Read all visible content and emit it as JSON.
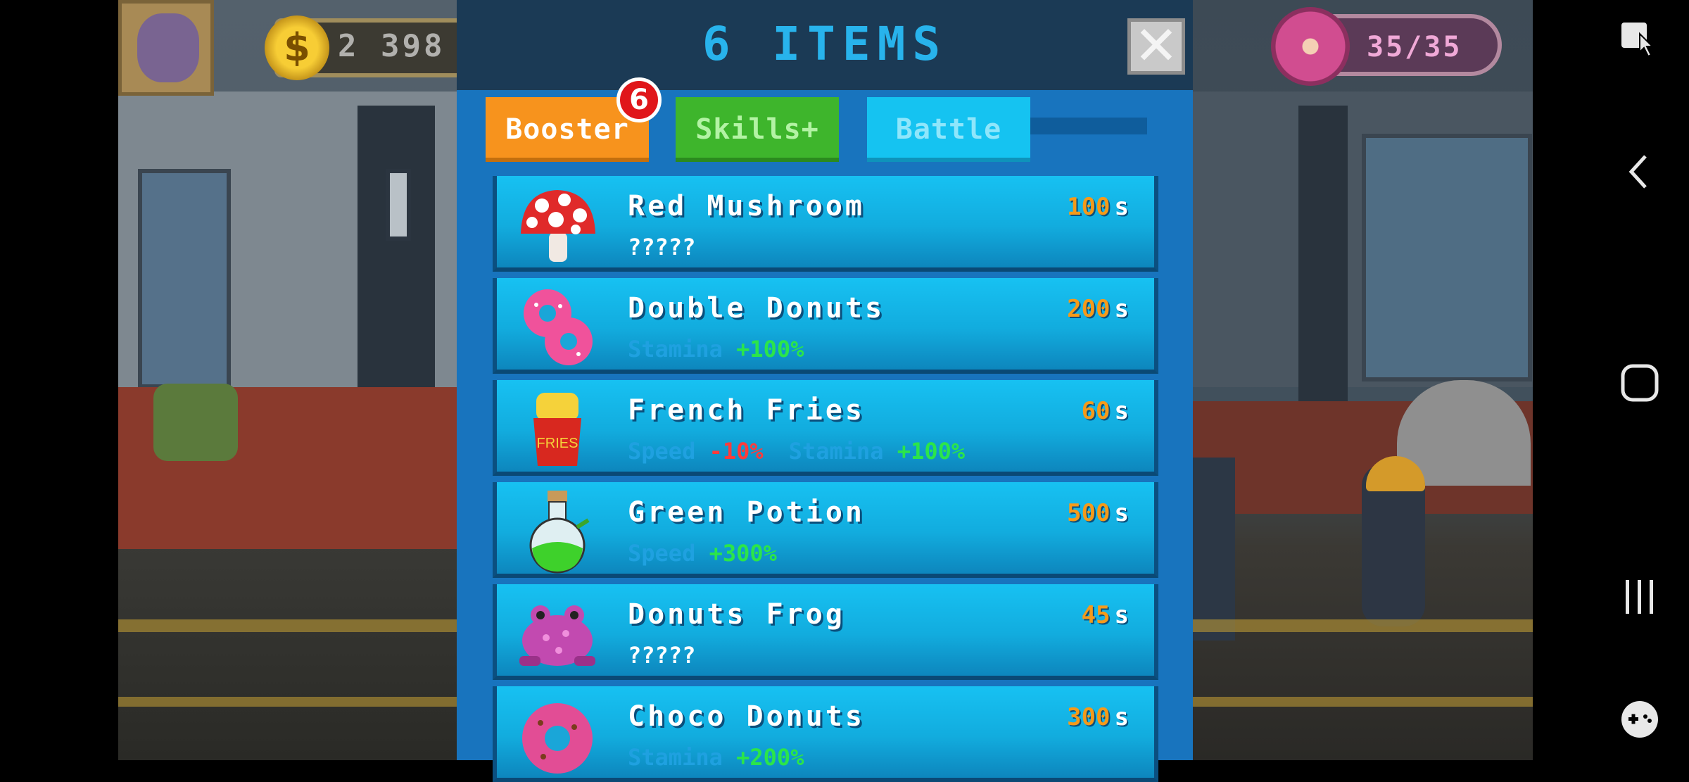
{
  "hud": {
    "coins": "2 398",
    "stamina": "35/35"
  },
  "modal": {
    "title": "6 ITEMS",
    "close_label": "✕",
    "tabs": [
      {
        "label": "Booster",
        "badge": "6"
      },
      {
        "label": "Skills+"
      },
      {
        "label": "Battle"
      }
    ]
  },
  "items": [
    {
      "name": "Red Mushroom",
      "time": "100",
      "unit": "s",
      "desc": "?????"
    },
    {
      "name": "Double Donuts",
      "time": "200",
      "unit": "s",
      "stat1_label": "Stamina",
      "stat1_value": "+100%"
    },
    {
      "name": "French Fries",
      "time": "60",
      "unit": "s",
      "stat1_label": "Speed",
      "stat1_value": "-10%",
      "stat2_label": "Stamina",
      "stat2_value": "+100%",
      "icon_text": "FRIES"
    },
    {
      "name": "Green Potion",
      "time": "500",
      "unit": "s",
      "stat1_label": "Speed",
      "stat1_value": "+300%"
    },
    {
      "name": "Donuts Frog",
      "time": "45",
      "unit": "s",
      "desc": "?????"
    },
    {
      "name": "Choco Donuts",
      "time": "300",
      "unit": "s",
      "stat1_label": "Stamina",
      "stat1_value": "+200%"
    }
  ],
  "colors": {
    "modal_title": "#28b3ec",
    "booster_tab": "#f7931d",
    "skills_tab": "#3eb52c",
    "battle_tab": "#15c3f1",
    "row": "#17c1f2",
    "time": "#f59a1a",
    "stat_plus": "#2be54a",
    "stat_minus": "#ff3b3b"
  },
  "nav": {
    "icons": [
      "screenshot-touch-icon",
      "back-icon",
      "home-icon",
      "recents-icon",
      "game-controller-icon"
    ]
  }
}
